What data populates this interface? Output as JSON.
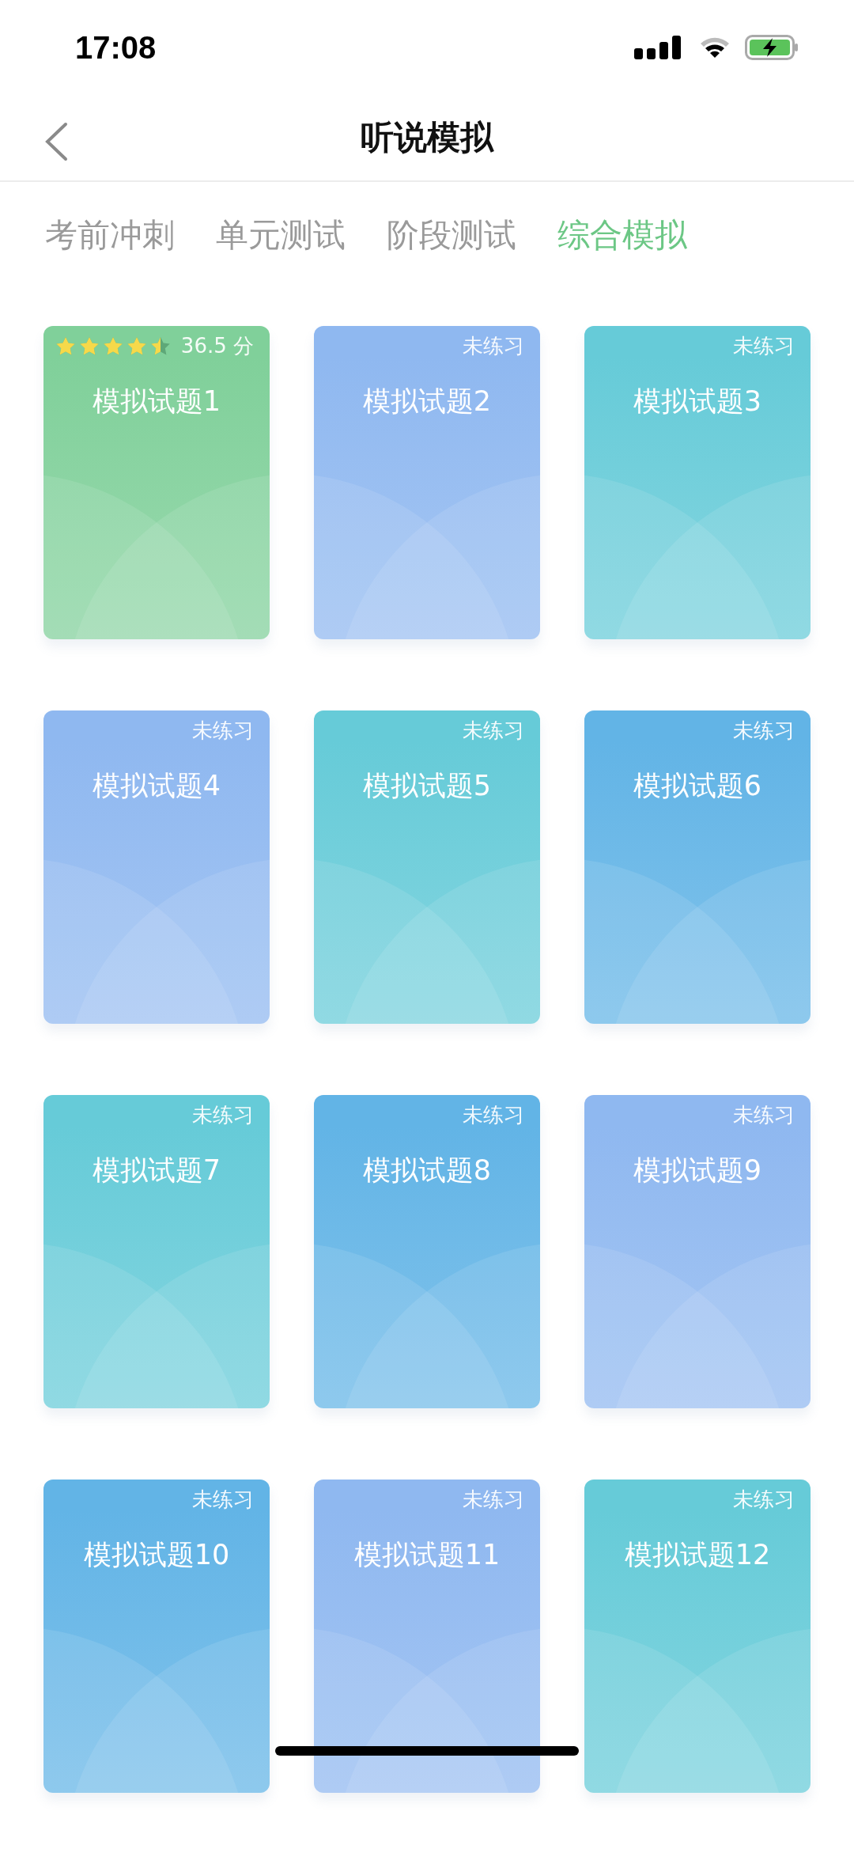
{
  "status_bar": {
    "time": "17:08"
  },
  "nav": {
    "title": "听说模拟"
  },
  "tabs": [
    {
      "label": "考前冲刺",
      "selected": false
    },
    {
      "label": "单元测试",
      "selected": false
    },
    {
      "label": "阶段测试",
      "selected": false
    },
    {
      "label": "综合模拟",
      "selected": true
    }
  ],
  "cards": [
    {
      "kind": "scored",
      "title": "模拟试题1",
      "stars": 4.5,
      "score": "36.5 分",
      "color": "#80d09a"
    },
    {
      "kind": "unpracticed",
      "title": "模拟试题2",
      "status": "未练习",
      "color": "#8fb8f0"
    },
    {
      "kind": "unpracticed",
      "title": "模拟试题3",
      "status": "未练习",
      "color": "#66cbd8"
    },
    {
      "kind": "unpracticed",
      "title": "模拟试题4",
      "status": "未练习",
      "color": "#8fb8f0"
    },
    {
      "kind": "unpracticed",
      "title": "模拟试题5",
      "status": "未练习",
      "color": "#66cbd8"
    },
    {
      "kind": "unpracticed",
      "title": "模拟试题6",
      "status": "未练习",
      "color": "#62b4e6"
    },
    {
      "kind": "unpracticed",
      "title": "模拟试题7",
      "status": "未练习",
      "color": "#66cbd8"
    },
    {
      "kind": "unpracticed",
      "title": "模拟试题8",
      "status": "未练习",
      "color": "#62b4e6"
    },
    {
      "kind": "unpracticed",
      "title": "模拟试题9",
      "status": "未练习",
      "color": "#8fb8f0"
    },
    {
      "kind": "unpracticed",
      "title": "模拟试题10",
      "status": "未练习",
      "color": "#62b4e6"
    },
    {
      "kind": "unpracticed",
      "title": "模拟试题11",
      "status": "未练习",
      "color": "#8fb8f0"
    },
    {
      "kind": "unpracticed",
      "title": "模拟试题12",
      "status": "未练习",
      "color": "#66cbd8"
    }
  ]
}
